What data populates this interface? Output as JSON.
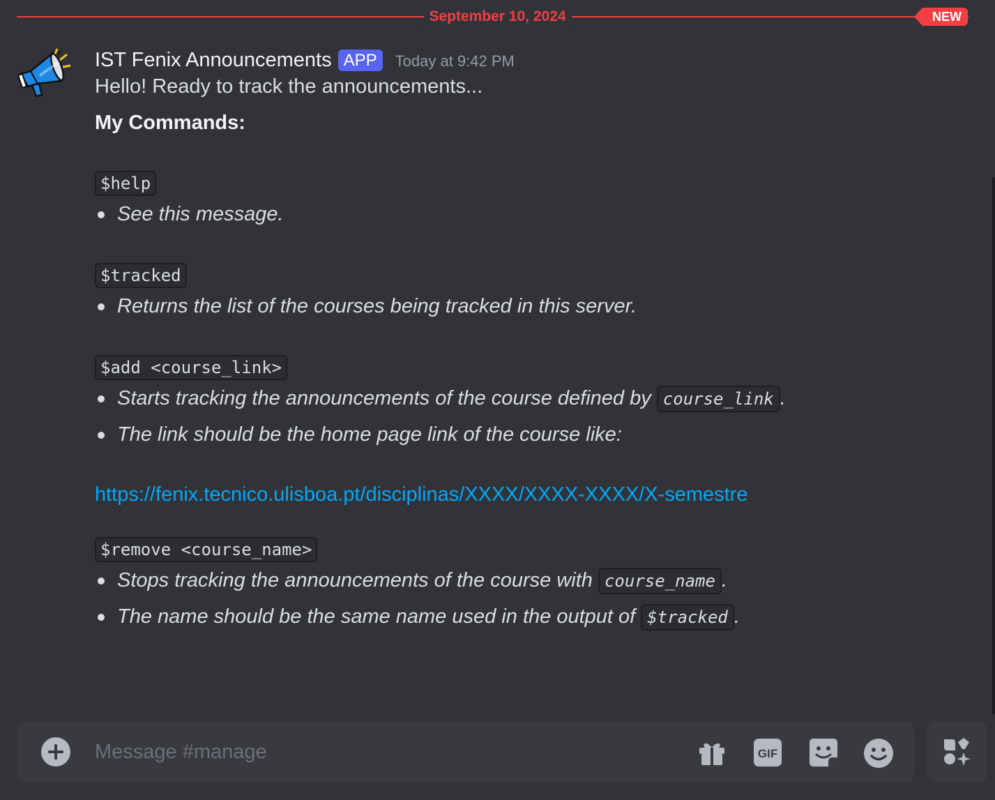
{
  "divider": {
    "date": "September 10, 2024",
    "badge": "NEW"
  },
  "message": {
    "author": "IST Fenix Announcements",
    "tag": "APP",
    "timestamp": "Today at 9:42 PM",
    "intro": "Hello! Ready to track the announcements...",
    "heading": "My Commands:",
    "commands": [
      {
        "command": "$help",
        "bullets": [
          "See this message."
        ]
      },
      {
        "command": "$tracked",
        "bullets": [
          "Returns the list of the courses being tracked in this server."
        ]
      },
      {
        "command": "$add <course_link>",
        "bullet1_text": "Starts tracking the announcements of the course defined by ",
        "bullet1_code": "course_link",
        "bullet1_tail": ".",
        "bullet2_text": "The link should be the home page link of the course like:",
        "link": "https://fenix.tecnico.ulisboa.pt/disciplinas/XXXX/XXXX-XXXX/X-semestre"
      },
      {
        "command": "$remove <course_name>",
        "bullet1_text": "Stops tracking the announcements of the course with ",
        "bullet1_code": "course_name",
        "bullet1_tail": ".",
        "bullet2_text": "The name should be the same name used in the output of ",
        "bullet2_code": "$tracked",
        "bullet2_tail": "."
      }
    ]
  },
  "composer": {
    "placeholder": "Message #manage",
    "icons": [
      "plus-circle-icon",
      "gift-icon",
      "gif-icon",
      "sticker-icon",
      "emoji-icon",
      "apps-icon"
    ],
    "gif_label": "GIF"
  },
  "colors": {
    "background": "#313338",
    "new_red": "#f23f43",
    "link_blue": "#00a8fc",
    "app_blurple": "#5865f2"
  }
}
